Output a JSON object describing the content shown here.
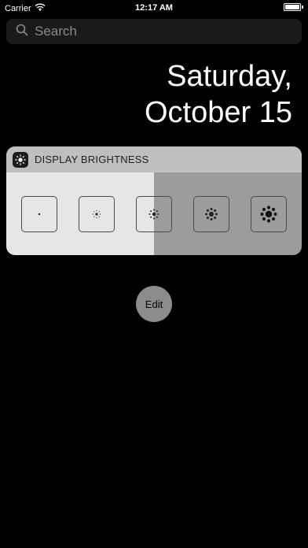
{
  "status_bar": {
    "carrier": "Carrier",
    "time": "12:17 AM",
    "battery_level": 1.0
  },
  "search": {
    "placeholder": "Search"
  },
  "date": {
    "weekday": "Saturday,",
    "month_day": "October 15"
  },
  "widget": {
    "title": "DISPLAY BRIGHTNESS",
    "levels": [
      "brightness-level-1",
      "brightness-level-2",
      "brightness-level-3",
      "brightness-level-4",
      "brightness-level-5"
    ]
  },
  "edit": {
    "label": "Edit"
  },
  "colors": {
    "background": "#000000",
    "widget_header": "#bfbfbf",
    "widget_light": "#e6e6e6",
    "widget_dark": "#9c9c9c",
    "edit_button": "#8c8c8c"
  }
}
